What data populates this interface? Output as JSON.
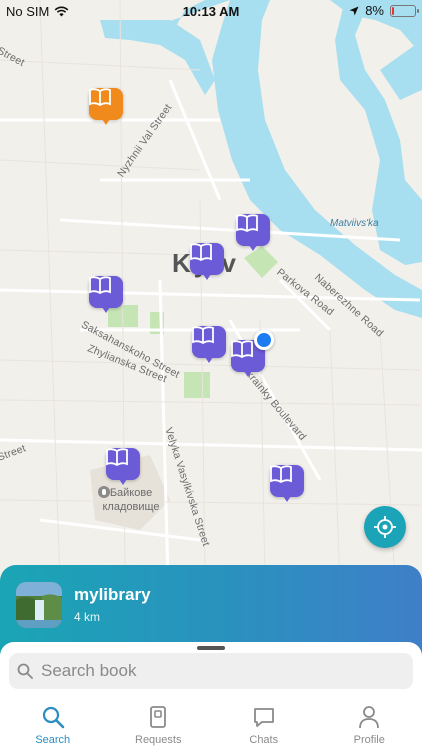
{
  "status_bar": {
    "carrier": "No SIM",
    "time": "10:13 AM",
    "battery": "8%",
    "battery_level": 0.08
  },
  "map": {
    "city_label": "Kyiv",
    "river_label": "Matviivs'ka",
    "cemetery_label_line1": "Байкове",
    "cemetery_label_line2": "кладовище",
    "streets": {
      "nyzhnii_val": "Nyzhnii Val Street",
      "parkova": "Parkova Road",
      "naberezhne": "Naberezhne Road",
      "saksahanskoho": "Saksahanskoho Street",
      "zhylianska": "Zhylianska Street",
      "ukrainky": "si Ukrainky Boulevard",
      "velyka_vasylkivska": "Velyka Vasylkivska Street",
      "edge_top": "Street",
      "edge_left": "Street"
    }
  },
  "selected_library": {
    "name": "mylibrary",
    "distance": "4 km"
  },
  "search": {
    "placeholder": "Search book"
  },
  "tabs": [
    {
      "label": "Search",
      "icon": "search-icon",
      "active": true
    },
    {
      "label": "Requests",
      "icon": "requests-icon",
      "active": false
    },
    {
      "label": "Chats",
      "icon": "chat-icon",
      "active": false
    },
    {
      "label": "Profile",
      "icon": "profile-icon",
      "active": false
    }
  ],
  "colors": {
    "accent": "#2a8fc0",
    "pin": "#6b5bd6",
    "pin_alt": "#f08a1c",
    "card_start": "#1aa5b5",
    "card_end": "#3f7fc8",
    "water": "#a7dff0"
  }
}
